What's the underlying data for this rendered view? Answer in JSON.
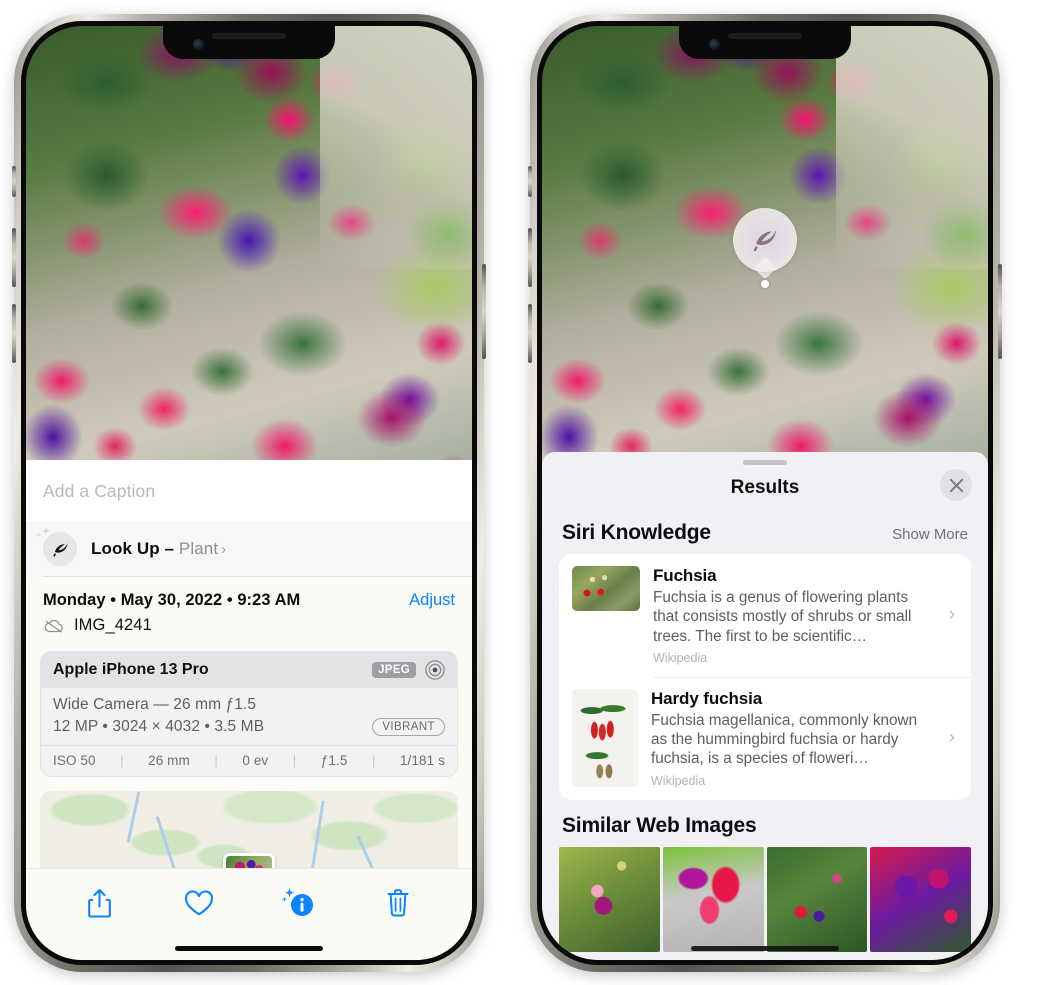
{
  "left_phone": {
    "caption_placeholder": "Add a Caption",
    "lookup": {
      "label": "Look Up –",
      "subject": "Plant",
      "chevron": "›",
      "icon": "leaf-icon"
    },
    "date": "Monday • May 30, 2022 • 9:23 AM",
    "adjust_label": "Adjust",
    "filename": "IMG_4241",
    "cloud_icon": "cloud-slash-icon",
    "exif": {
      "device": "Apple iPhone 13 Pro",
      "format_badge": "JPEG",
      "raw_icon": "aperture-icon",
      "lens_line": "Wide Camera — 26 mm ƒ1.5",
      "size_line": "12 MP • 3024 × 4032 • 3.5 MB",
      "style_badge": "VIBRANT",
      "stats": [
        "ISO 50",
        "26 mm",
        "0 ev",
        "ƒ1.5",
        "1/181 s"
      ]
    },
    "toolbar": [
      {
        "name": "share-button",
        "icon": "share-icon"
      },
      {
        "name": "favorite-button",
        "icon": "heart-icon"
      },
      {
        "name": "info-button",
        "icon": "info-sparkle-icon"
      },
      {
        "name": "delete-button",
        "icon": "trash-icon"
      }
    ]
  },
  "right_phone": {
    "badge": {
      "icon": "leaf-icon"
    },
    "panel": {
      "title": "Results",
      "close_icon": "close-icon",
      "sections": [
        {
          "heading": "Siri Knowledge",
          "action": "Show More",
          "cards": [
            {
              "title": "Fuchsia",
              "desc": "Fuchsia is a genus of flowering plants that consists mostly of shrubs or small trees. The first to be scientific…",
              "source": "Wikipedia",
              "chevron": "›"
            },
            {
              "title": "Hardy fuchsia",
              "desc": "Fuchsia magellanica, commonly known as the hummingbird fuchsia or hardy fuchsia, is a species of floweri…",
              "source": "Wikipedia",
              "chevron": "›"
            }
          ]
        },
        {
          "heading": "Similar Web Images",
          "images": [
            "web-image-1",
            "web-image-2",
            "web-image-3",
            "web-image-4"
          ]
        }
      ]
    }
  },
  "colors": {
    "accent_blue": "#0a84ff",
    "panel_bg": "#f1f1f5",
    "sheet_bg": "#fbfbf6",
    "card_bg": "#ffffff"
  }
}
